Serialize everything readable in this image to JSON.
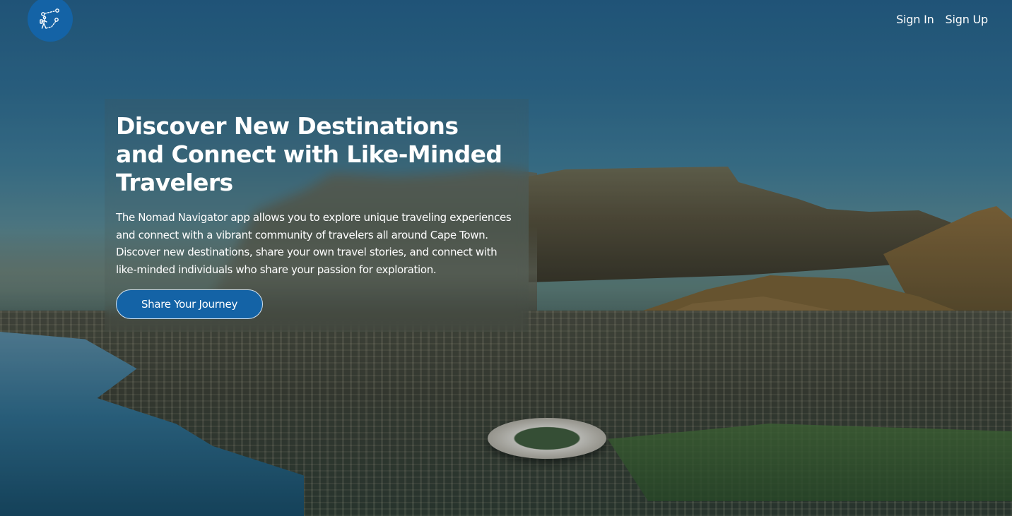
{
  "nav": {
    "sign_in": "Sign In",
    "sign_up": "Sign Up"
  },
  "hero": {
    "title": "Discover New Destinations and Connect with Like-Minded Travelers",
    "description": "The Nomad Navigator app allows you to explore unique traveling experiences and connect with a vibrant community of travelers all around Cape Town. Discover new destinations, share your own travel stories, and connect with like-minded individuals who share your passion for exploration.",
    "cta_label": "Share Your Journey"
  },
  "icons": {
    "logo": "traveler-route-icon"
  },
  "colors": {
    "brand": "#1463a6",
    "text": "#ffffff"
  }
}
